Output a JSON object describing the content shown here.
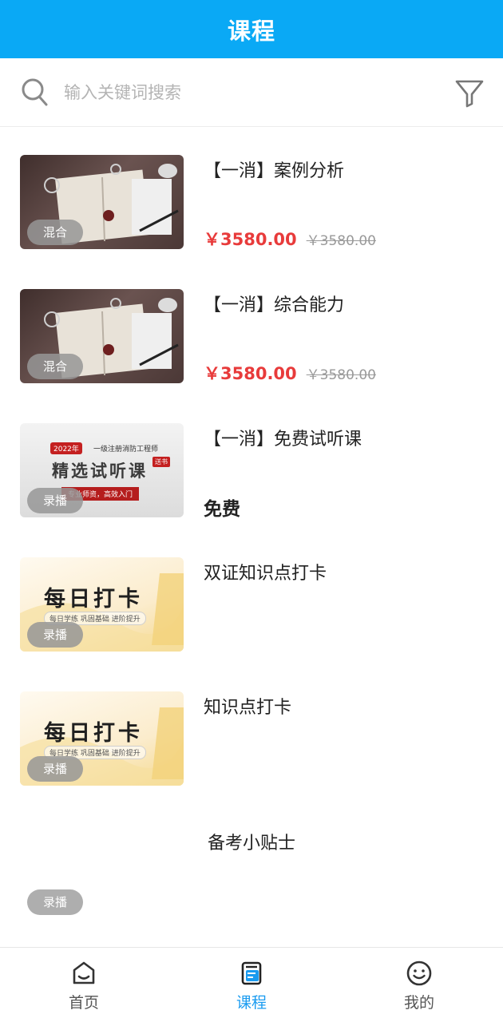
{
  "header": {
    "title": "课程"
  },
  "search": {
    "placeholder": "输入关键词搜索"
  },
  "courses": [
    {
      "name": "【一消】案例分析",
      "badge": "混合",
      "price": "￥3580.00",
      "old_price": "￥3580.00",
      "thumb": "desk-photo"
    },
    {
      "name": "【一消】综合能力",
      "badge": "混合",
      "price": "￥3580.00",
      "old_price": "￥3580.00",
      "thumb": "desk-photo"
    },
    {
      "name": "【一消】免费试听课",
      "badge": "录播",
      "free": "免费",
      "thumb": "trial-banner",
      "thumb_text": {
        "year": "2022年",
        "subtitle": "一级注册消防工程师",
        "title": "精选试听课",
        "tag": "送书",
        "slogan": "专业师资，高效入门"
      }
    },
    {
      "name": "双证知识点打卡",
      "badge": "录播",
      "thumb": "daily-checkin",
      "thumb_text": {
        "title": "每日打卡",
        "slogan": "每日学练 巩固基础 进阶提升"
      }
    },
    {
      "name": "知识点打卡",
      "badge": "录播",
      "thumb": "daily-checkin",
      "thumb_text": {
        "title": "每日打卡",
        "slogan": "每日学练 巩固基础 进阶提升"
      }
    },
    {
      "name": "备考小贴士",
      "badge": "录播",
      "thumb": "none"
    }
  ],
  "tabbar": {
    "items": [
      {
        "label": "首页",
        "icon": "home-icon"
      },
      {
        "label": "课程",
        "icon": "course-icon",
        "active": true
      },
      {
        "label": "我的",
        "icon": "profile-icon"
      }
    ]
  },
  "colors": {
    "header": "#0aa9f5",
    "price": "#e83b3b",
    "active_tab": "#1a9bf0"
  }
}
